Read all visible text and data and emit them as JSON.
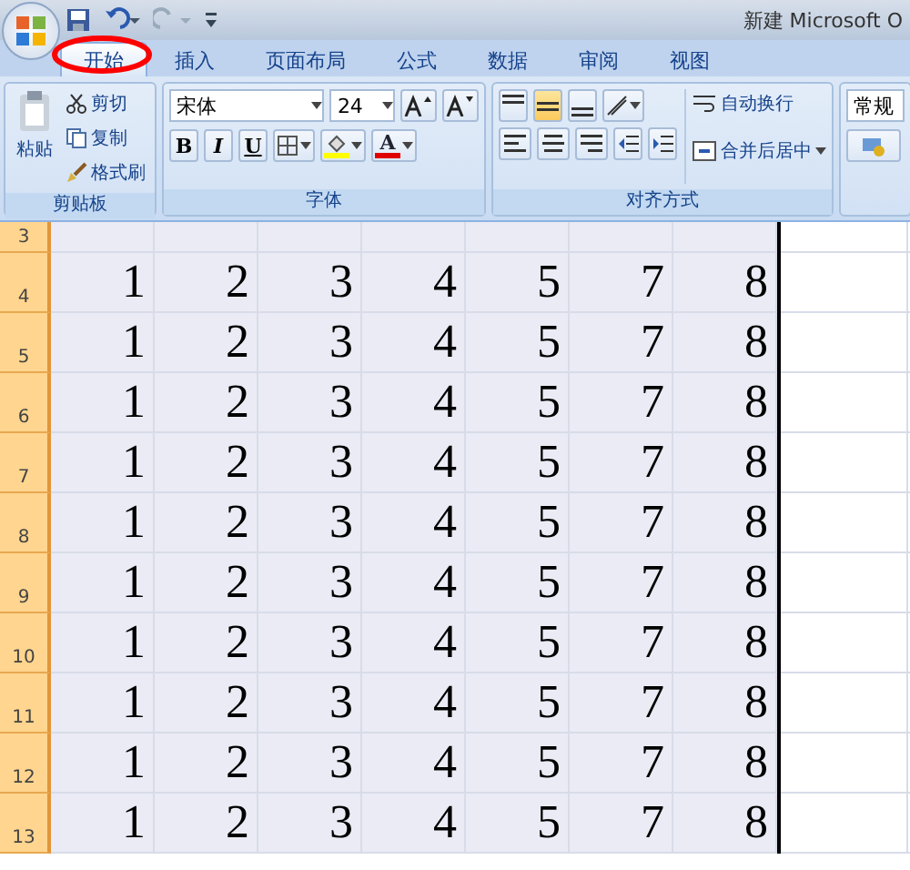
{
  "window": {
    "title": "新建 Microsoft O"
  },
  "tabs": [
    {
      "label": "开始",
      "selected": true
    },
    {
      "label": "插入",
      "selected": false
    },
    {
      "label": "页面布局",
      "selected": false
    },
    {
      "label": "公式",
      "selected": false
    },
    {
      "label": "数据",
      "selected": false
    },
    {
      "label": "审阅",
      "selected": false
    },
    {
      "label": "视图",
      "selected": false
    }
  ],
  "clipboard": {
    "title": "剪贴板",
    "paste": "粘贴",
    "cut": "剪切",
    "copy": "复制",
    "format_painter": "格式刷"
  },
  "font": {
    "title": "字体",
    "font_name": "宋体",
    "font_size": "24",
    "bold": "B",
    "italic": "I",
    "underline": "U",
    "font_color": "A"
  },
  "alignment": {
    "title": "对齐方式",
    "vertical": [
      {
        "selected": false
      },
      {
        "selected": true
      },
      {
        "selected": false
      }
    ],
    "wrap_text": "自动换行",
    "merge_center": "合并后居中"
  },
  "number": {
    "format": "常规"
  },
  "sheet": {
    "rows": [
      {
        "header": "3",
        "selected": true
      },
      {
        "header": "4",
        "selected": true,
        "cells": [
          "1",
          "2",
          "3",
          "4",
          "5",
          "7",
          "8"
        ]
      },
      {
        "header": "5",
        "selected": true,
        "cells": [
          "1",
          "2",
          "3",
          "4",
          "5",
          "7",
          "8"
        ]
      },
      {
        "header": "6",
        "selected": true,
        "cells": [
          "1",
          "2",
          "3",
          "4",
          "5",
          "7",
          "8"
        ]
      },
      {
        "header": "7",
        "selected": true,
        "cells": [
          "1",
          "2",
          "3",
          "4",
          "5",
          "7",
          "8"
        ]
      },
      {
        "header": "8",
        "selected": true,
        "cells": [
          "1",
          "2",
          "3",
          "4",
          "5",
          "7",
          "8"
        ]
      },
      {
        "header": "9",
        "selected": true,
        "cells": [
          "1",
          "2",
          "3",
          "4",
          "5",
          "7",
          "8"
        ]
      },
      {
        "header": "10",
        "selected": true,
        "cells": [
          "1",
          "2",
          "3",
          "4",
          "5",
          "7",
          "8"
        ]
      },
      {
        "header": "11",
        "selected": true,
        "cells": [
          "1",
          "2",
          "3",
          "4",
          "5",
          "7",
          "8"
        ]
      },
      {
        "header": "12",
        "selected": true,
        "cells": [
          "1",
          "2",
          "3",
          "4",
          "5",
          "7",
          "8"
        ]
      },
      {
        "header": "13",
        "selected": true,
        "cells": [
          "1",
          "2",
          "3",
          "4",
          "5",
          "7",
          "8"
        ]
      }
    ]
  }
}
